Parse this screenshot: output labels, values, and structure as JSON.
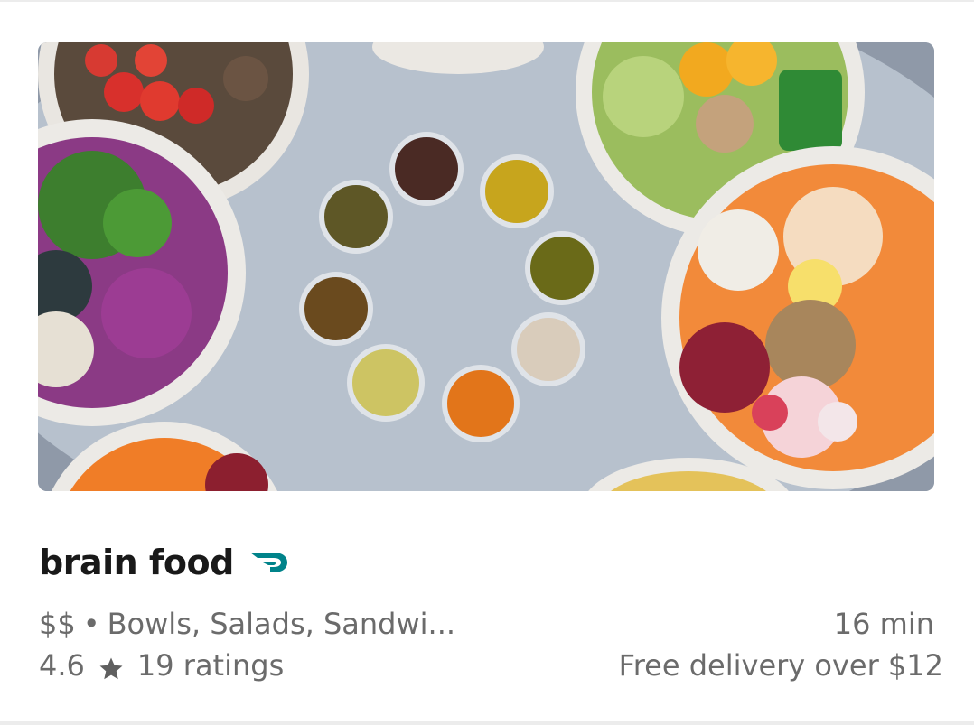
{
  "store": {
    "name": "brain food",
    "badge_icon": "dashpass-icon",
    "price_range": "$$",
    "separator": "•",
    "cuisines": "Bowls, Salads, Sandwi...",
    "rating": "4.6",
    "rating_icon": "star-icon",
    "ratings_count": "19 ratings",
    "eta": "16 min",
    "delivery_fee": "Free delivery over $12"
  },
  "colors": {
    "title_text": "#191919",
    "meta_text": "#6b6b6b",
    "dashpass_teal": "#00838a",
    "divider": "#ececec"
  }
}
